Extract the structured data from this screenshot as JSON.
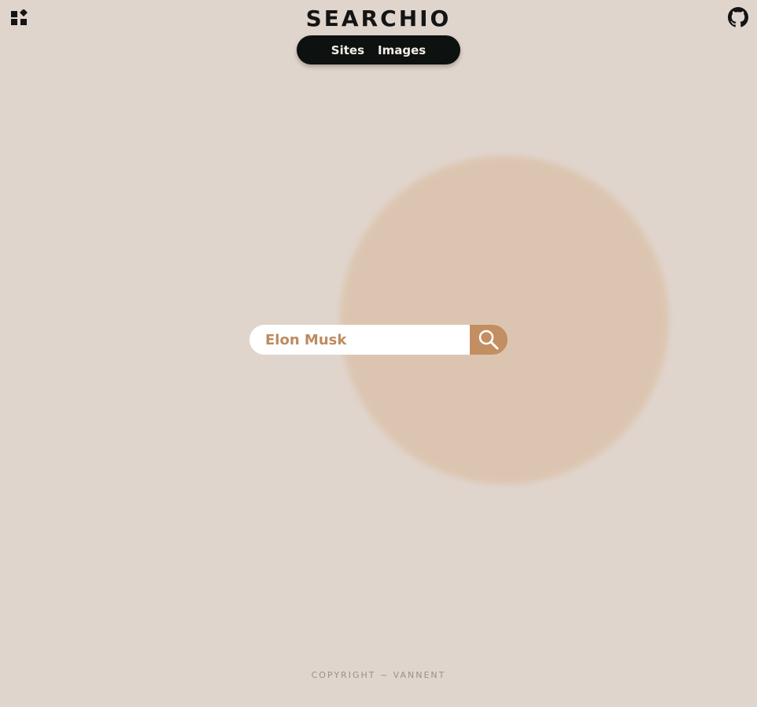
{
  "header": {
    "logo": "SEARCHIO",
    "tabs": [
      {
        "label": "Sites"
      },
      {
        "label": "Images"
      }
    ]
  },
  "icons": {
    "apps": "apps-icon",
    "github": "github-icon",
    "search": "search-icon"
  },
  "search": {
    "value": "Elon Musk"
  },
  "footer": {
    "text": "COPYRIGHT ~ VANNENT"
  },
  "colors": {
    "background": "#e0d5cd",
    "blob": "#dcc5b0",
    "accent": "#c38e62",
    "input_text": "#bd8b5f",
    "tab_bar": "#0d110f",
    "logo": "#141414"
  }
}
